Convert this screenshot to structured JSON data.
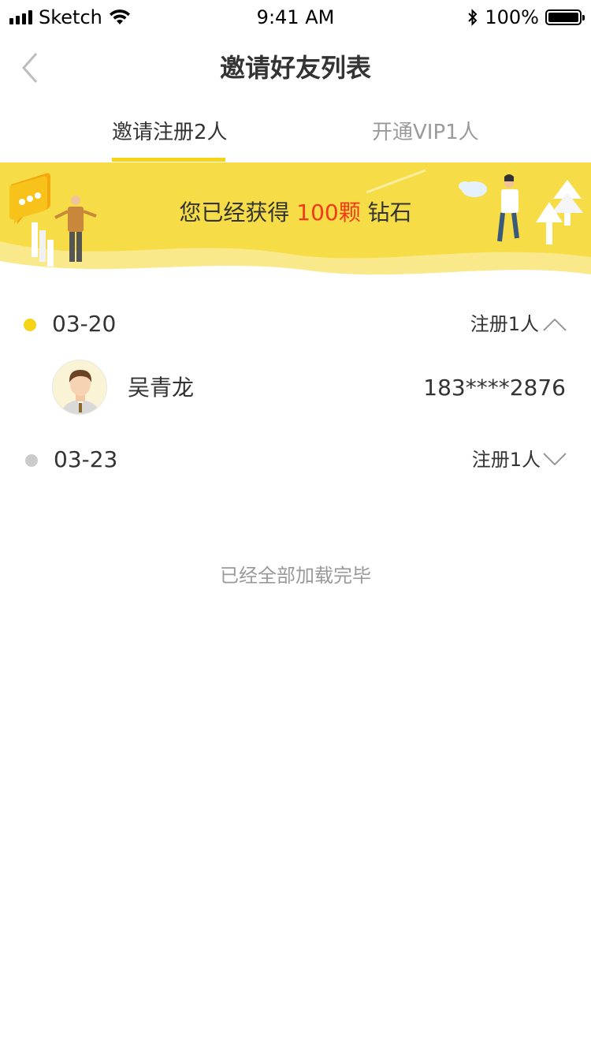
{
  "status_bar": {
    "carrier": "Sketch",
    "time": "9:41 AM",
    "battery": "100%"
  },
  "nav": {
    "title": "邀请好友列表"
  },
  "tabs": [
    {
      "label": "邀请注册2人",
      "active": true
    },
    {
      "label": "开通VIP1人",
      "active": false
    }
  ],
  "banner": {
    "prefix": "您已经获得",
    "highlight": "100颗",
    "suffix": "钻石"
  },
  "groups": [
    {
      "date": "03-20",
      "count": "注册1人",
      "expanded": true,
      "dot_color": "#f7d316",
      "users": [
        {
          "name": "吴青龙",
          "phone": "183****2876"
        }
      ]
    },
    {
      "date": "03-23",
      "count": "注册1人",
      "expanded": false,
      "dot_color": "#cccccc",
      "users": []
    }
  ],
  "footer": {
    "load_done": "已经全部加载完毕"
  },
  "colors": {
    "accent": "#f7d316",
    "banner_bg": "#f6dc47",
    "highlight": "#f23a1a"
  }
}
